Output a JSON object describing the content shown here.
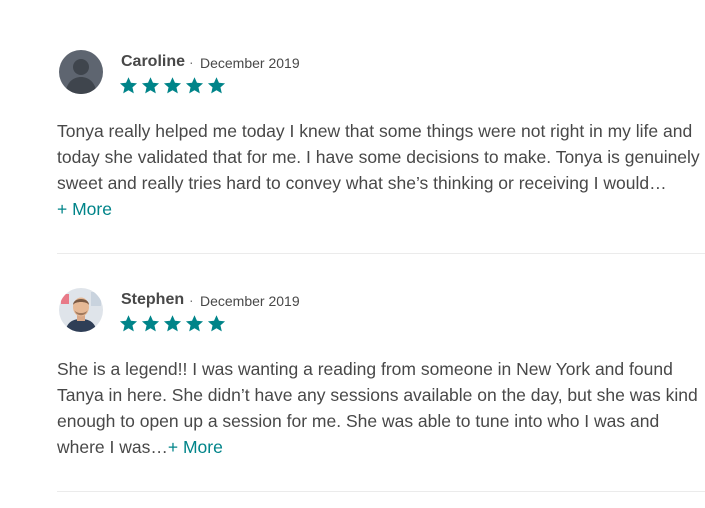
{
  "colors": {
    "star": "#008489",
    "link": "#008489",
    "text": "#484848",
    "divider": "#ebebeb"
  },
  "reviews": [
    {
      "name": "Caroline",
      "separator": "·",
      "date": "December 2019",
      "rating": 5,
      "avatar": "default-user-avatar",
      "lines": [
        "Tonya really helped me today I knew that some things were not right in my life and",
        "today she validated that for me. I have some decisions to make. Tonya is genuinely",
        "sweet and really tries hard to convey what she’s thinking or receiving I would…"
      ],
      "more_label": "+ More"
    },
    {
      "name": "Stephen",
      "separator": "·",
      "date": "December 2019",
      "rating": 5,
      "avatar": "user-photo-avatar",
      "lines": [
        "She is a legend!! I was wanting a reading from someone in New York and found",
        "Tanya in here. She didn’t have any sessions available on the day, but she was kind",
        "enough to open up a session for me. She was able to tune into who I was and",
        "where I was…"
      ],
      "more_label": "+ More"
    }
  ]
}
